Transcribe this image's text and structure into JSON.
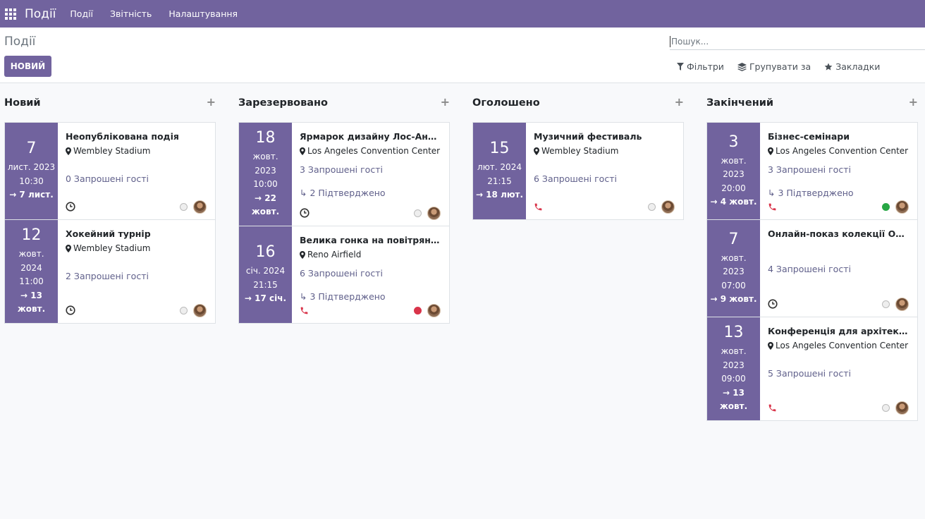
{
  "navbar": {
    "brand": "Події",
    "menu": [
      "Події",
      "Звітність",
      "Налаштування"
    ]
  },
  "control": {
    "breadcrumb": "Події",
    "new_button": "НОВИЙ",
    "search_placeholder": "Пошук...",
    "filters_label": "Фільтри",
    "group_by_label": "Групувати за",
    "favorites_label": "Закладки"
  },
  "colors": {
    "primary": "#71639e",
    "green": "#28a745",
    "red": "#d9344a"
  },
  "columns": [
    {
      "title": "Новий",
      "cards": [
        {
          "day": "7",
          "date_lines": [
            "лист. 2023",
            "10:30"
          ],
          "end_lines": [
            "→ 7 лист."
          ],
          "name": "Неопублікована подія",
          "location": "Wembley Stadium",
          "guests": "0 Запрошені гості",
          "confirmed": "",
          "activity": "clock",
          "status": "grey"
        },
        {
          "day": "12",
          "date_lines": [
            "жовт.",
            "2024",
            "11:00"
          ],
          "end_lines": [
            "→ 13",
            "жовт."
          ],
          "name": "Хокейний турнір",
          "location": "Wembley Stadium",
          "guests": "2 Запрошені гості",
          "confirmed": "",
          "activity": "clock",
          "status": "grey"
        }
      ]
    },
    {
      "title": "Зарезервовано",
      "cards": [
        {
          "day": "18",
          "date_lines": [
            "жовт.",
            "2023",
            "10:00"
          ],
          "end_lines": [
            "→ 22",
            "жовт."
          ],
          "name": "Ярмарок дизайну Лос-Анджелеса",
          "location": "Los Angeles Convention Center",
          "guests": "3 Запрошені гості",
          "confirmed": "↳ 2 Підтверджено",
          "activity": "clock",
          "status": "grey"
        },
        {
          "day": "16",
          "date_lines": [
            "січ. 2024",
            "21:15"
          ],
          "end_lines": [
            "→ 17 січ."
          ],
          "name": "Велика гонка на повітряній кулі",
          "location": "Reno Airfield",
          "guests": "6 Запрошені гості",
          "confirmed": "↳ 3 Підтверджено",
          "activity": "phone",
          "status": "red"
        }
      ]
    },
    {
      "title": "Оголошено",
      "cards": [
        {
          "day": "15",
          "date_lines": [
            "лют. 2024",
            "21:15"
          ],
          "end_lines": [
            "→ 18 лют."
          ],
          "name": "Музичний фестиваль",
          "location": "Wembley Stadium",
          "guests": "6 Запрошені гості",
          "confirmed": "",
          "activity": "phone",
          "status": "grey"
        }
      ]
    },
    {
      "title": "Закінчений",
      "cards": [
        {
          "day": "3",
          "date_lines": [
            "жовт.",
            "2023",
            "20:00"
          ],
          "end_lines": [
            "→ 4 жовт."
          ],
          "name": "Бізнес-семінари",
          "location": "Los Angeles Convention Center",
          "guests": "3 Запрошені гості",
          "confirmed": "↳ 3 Підтверджено",
          "activity": "phone",
          "status": "green"
        },
        {
          "day": "7",
          "date_lines": [
            "жовт.",
            "2023",
            "07:00"
          ],
          "end_lines": [
            "→ 9 жовт."
          ],
          "name": "Онлайн-показ колекції OpenWood",
          "location": "",
          "guests": "4 Запрошені гості",
          "confirmed": "",
          "activity": "clock",
          "status": "grey"
        },
        {
          "day": "13",
          "date_lines": [
            "жовт.",
            "2023",
            "09:00"
          ],
          "end_lines": [
            "→ 13",
            "жовт."
          ],
          "name": "Конференція для архітекторів",
          "location": "Los Angeles Convention Center",
          "guests": "5 Запрошені гості",
          "confirmed": "",
          "activity": "phone",
          "status": "grey"
        }
      ]
    }
  ]
}
